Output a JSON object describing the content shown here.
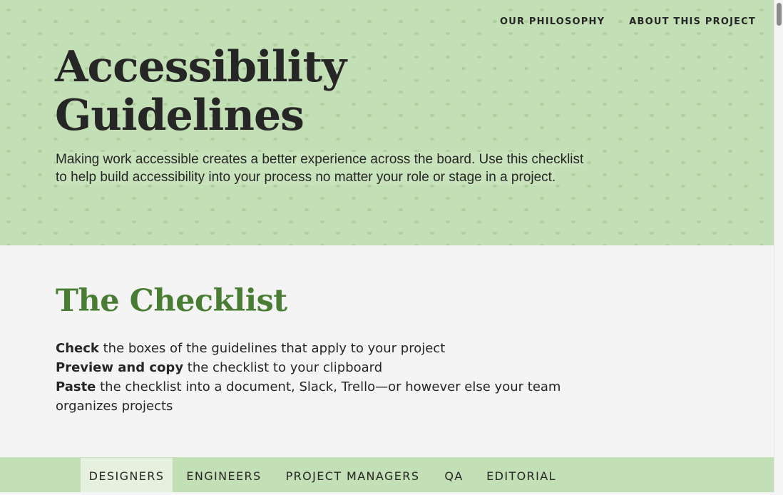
{
  "nav": {
    "links": [
      "OUR PHILOSOPHY",
      "ABOUT THIS PROJECT"
    ]
  },
  "hero": {
    "title_line1": "Accessibility",
    "title_line2": "Guidelines",
    "intro": "Making work accessible creates a better experience across the board. Use this checklist to help build accessibility into your process no matter your role or stage in a project."
  },
  "checklist": {
    "title": "The Checklist",
    "steps": [
      {
        "strong": "Check",
        "text": " the boxes of the guidelines that apply to your project"
      },
      {
        "strong": "Preview and copy",
        "text": " the checklist to your clipboard"
      },
      {
        "strong": "Paste",
        "text": " the checklist into a document, Slack, Trello—or however else your team organizes projects"
      }
    ]
  },
  "tabs": {
    "items": [
      "DESIGNERS",
      "ENGINEERS",
      "PROJECT MANAGERS",
      "QA",
      "EDITORIAL"
    ],
    "active": "DESIGNERS"
  },
  "colors": {
    "hero_bg": "#c3dfb5",
    "accent_green": "#4a7d34",
    "active_tab_bg": "#e5f1de",
    "text": "#262626"
  }
}
